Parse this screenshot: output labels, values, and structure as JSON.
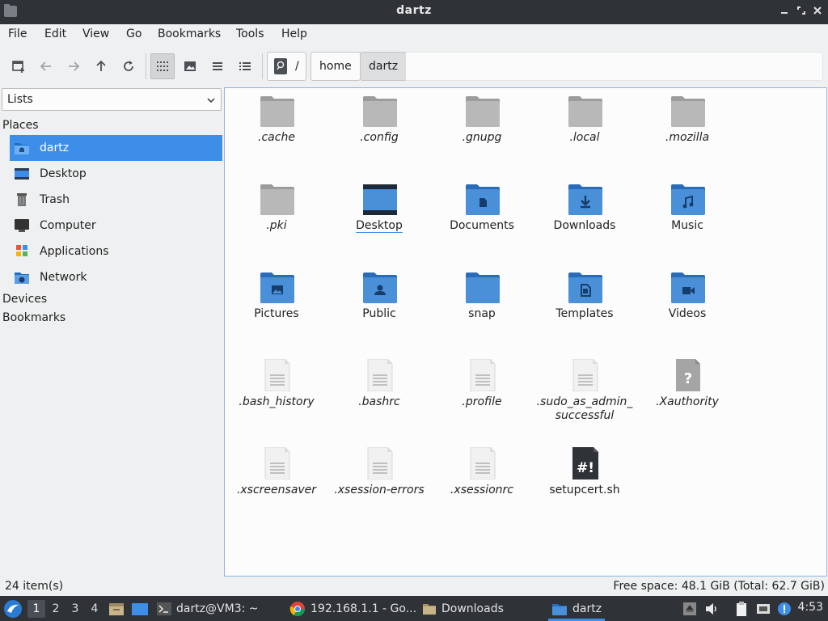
{
  "window": {
    "title": "dartz"
  },
  "menubar": [
    "File",
    "Edit",
    "View",
    "Go",
    "Bookmarks",
    "Tools",
    "Help"
  ],
  "breadcrumb": {
    "root": "/",
    "segments": [
      "home",
      "dartz"
    ]
  },
  "sidebar": {
    "dropdown": "Lists",
    "places_title": "Places",
    "places": [
      {
        "label": "dartz",
        "icon": "home-folder-icon"
      },
      {
        "label": "Desktop",
        "icon": "desktop-icon"
      },
      {
        "label": "Trash",
        "icon": "trash-icon"
      },
      {
        "label": "Computer",
        "icon": "computer-icon"
      },
      {
        "label": "Applications",
        "icon": "applications-icon"
      },
      {
        "label": "Network",
        "icon": "network-icon"
      }
    ],
    "devices_title": "Devices",
    "bookmarks_title": "Bookmarks"
  },
  "files": [
    {
      "name": ".cache",
      "type": "folder-hidden"
    },
    {
      "name": ".config",
      "type": "folder-hidden"
    },
    {
      "name": ".gnupg",
      "type": "folder-hidden"
    },
    {
      "name": ".local",
      "type": "folder-hidden"
    },
    {
      "name": ".mozilla",
      "type": "folder-hidden"
    },
    {
      "name": ".pki",
      "type": "folder-hidden"
    },
    {
      "name": "Desktop",
      "type": "desktop"
    },
    {
      "name": "Documents",
      "type": "documents"
    },
    {
      "name": "Downloads",
      "type": "downloads"
    },
    {
      "name": "Music",
      "type": "music"
    },
    {
      "name": "Pictures",
      "type": "pictures"
    },
    {
      "name": "Public",
      "type": "public"
    },
    {
      "name": "snap",
      "type": "folder"
    },
    {
      "name": "Templates",
      "type": "templates"
    },
    {
      "name": "Videos",
      "type": "videos"
    },
    {
      "name": ".bash_history",
      "type": "text-hidden"
    },
    {
      "name": ".bashrc",
      "type": "text-hidden"
    },
    {
      "name": ".profile",
      "type": "text-hidden"
    },
    {
      "name": ".sudo_as_admin_\nsuccessful",
      "type": "text-hidden"
    },
    {
      "name": ".Xauthority",
      "type": "unknown-hidden"
    },
    {
      "name": ".xscreensaver",
      "type": "text-hidden"
    },
    {
      "name": ".xsession-errors",
      "type": "text-hidden"
    },
    {
      "name": ".xsessionrc",
      "type": "text-hidden"
    },
    {
      "name": "setupcert.sh",
      "type": "script"
    }
  ],
  "status": {
    "count": "24 item(s)",
    "free_space": "Free space: 48.1 GiB (Total: 62.7 GiB)"
  },
  "taskbar": {
    "workspaces": [
      "1",
      "2",
      "3",
      "4"
    ],
    "tasks": [
      "dartz@VM3: ~",
      "192.168.1.1 - Go...",
      "Downloads",
      "dartz"
    ],
    "clock": "4:53"
  },
  "colors": {
    "accent": "#3d8ee8",
    "folder_blue": "#4a90d9",
    "folder_gray": "#b5b5b5"
  }
}
